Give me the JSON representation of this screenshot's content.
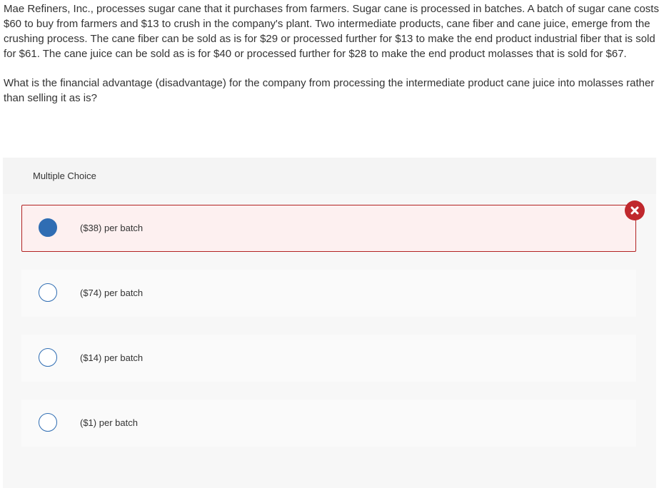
{
  "question": {
    "body": "Mae Refiners, Inc., processes sugar cane that it purchases from farmers. Sugar cane is processed in batches. A batch of sugar cane costs $60 to buy from farmers and $13 to crush in the company's plant. Two intermediate products, cane fiber and cane juice, emerge from the crushing process. The cane fiber can be sold as is for $29 or processed further for $13 to make the end product industrial fiber that is sold for $61. The cane juice can be sold as is for $40 or processed further for $28 to make the end product molasses that is sold for $67.",
    "prompt": "What is the financial advantage (disadvantage) for the company from processing the intermediate product cane juice into molasses rather than selling it as is?"
  },
  "multiple_choice": {
    "header": "Multiple Choice",
    "options": [
      {
        "label": "($38) per batch",
        "selected": true,
        "status": "incorrect"
      },
      {
        "label": "($74) per batch",
        "selected": false
      },
      {
        "label": "($14) per batch",
        "selected": false
      },
      {
        "label": "($1) per batch",
        "selected": false
      }
    ]
  },
  "icons": {
    "incorrect": "x-mark-icon"
  },
  "colors": {
    "radio": "#2f6db3",
    "incorrect_border": "#b22222",
    "incorrect_background": "#fdf0f0",
    "incorrect_badge": "#c0282d",
    "panel_background": "#f4f4f4"
  }
}
